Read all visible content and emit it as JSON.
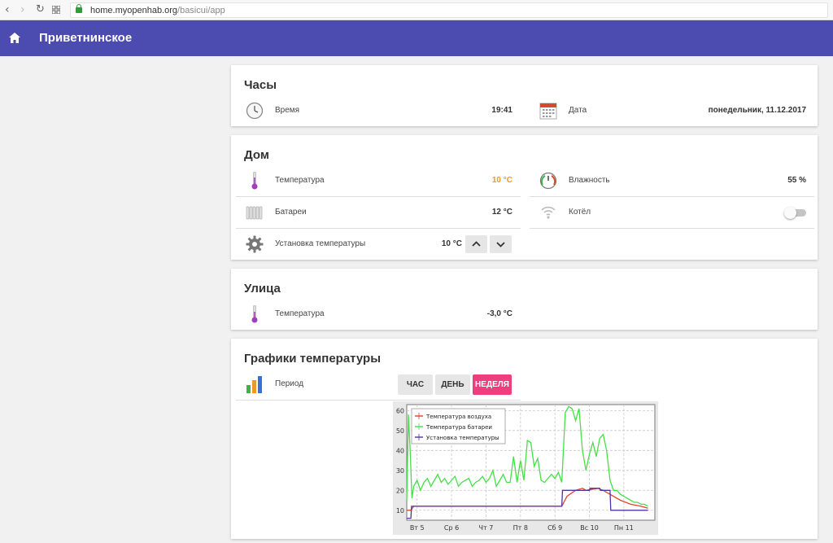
{
  "browser": {
    "url_host": "home.myopenhab.org",
    "url_path": "/basicui/app"
  },
  "header": {
    "title": "Приветнинское"
  },
  "clock": {
    "title": "Часы",
    "time_label": "Время",
    "time_value": "19:41",
    "date_label": "Дата",
    "date_value": "понедельник, 11.12.2017"
  },
  "home": {
    "title": "Дом",
    "temperature_label": "Температура",
    "temperature_value": "10 °C",
    "humidity_label": "Влажность",
    "humidity_value": "55 %",
    "radiators_label": "Батареи",
    "radiators_value": "12 °C",
    "boiler_label": "Котёл",
    "boiler_on": false,
    "setpoint_label": "Установка температуры",
    "setpoint_value": "10 °C"
  },
  "street": {
    "title": "Улица",
    "temperature_label": "Температура",
    "temperature_value": "-3,0 °C"
  },
  "charts": {
    "title": "Графики температуры",
    "period_label": "Период",
    "periods": [
      "ЧАС",
      "ДЕНЬ",
      "НЕДЕЛЯ"
    ],
    "selected_period": "НЕДЕЛЯ"
  },
  "colors": {
    "appbar": "#4c4bb0",
    "accent_pink": "#ef3e7d",
    "temperature_highlight": "#e99a2a",
    "series_air": "#d9482b",
    "series_battery": "#44e048",
    "series_setpoint": "#5231a8"
  },
  "chart_data": {
    "type": "line",
    "title": "",
    "xlabel": "",
    "ylabel": "",
    "categories": [
      "Вт 5",
      "Ср 6",
      "Чт 7",
      "Пт 8",
      "Сб 9",
      "Вс 10",
      "Пн 11"
    ],
    "x_ticks": [
      0.3,
      1.3,
      2.3,
      3.3,
      4.3,
      5.3,
      6.3
    ],
    "y_ticks": [
      10,
      20,
      30,
      40,
      50,
      60
    ],
    "xlim": [
      0,
      7.2
    ],
    "ylim": [
      5,
      63
    ],
    "grid": true,
    "legend": "top-left",
    "series": [
      {
        "name": "Температура воздуха",
        "x": [
          0,
          0.12,
          0.2,
          0.4,
          1.0,
          1.5,
          2.0,
          2.6,
          3.0,
          3.5,
          4.0,
          4.4,
          4.5,
          4.65,
          4.9,
          5.1,
          5.2,
          5.55,
          5.7,
          5.9,
          6.2,
          6.5,
          6.8,
          7.0
        ],
        "values": [
          10,
          10,
          12,
          12,
          12,
          12,
          12,
          12,
          12,
          12,
          12,
          12,
          12,
          17,
          20,
          21,
          20,
          21,
          20,
          18,
          15,
          13,
          12,
          11
        ]
      },
      {
        "name": "Температура батареи",
        "x": [
          0,
          0.05,
          0.1,
          0.15,
          0.2,
          0.3,
          0.4,
          0.5,
          0.6,
          0.7,
          0.8,
          0.9,
          1.0,
          1.1,
          1.2,
          1.3,
          1.4,
          1.5,
          1.6,
          1.7,
          1.8,
          1.9,
          2.0,
          2.1,
          2.2,
          2.3,
          2.4,
          2.5,
          2.6,
          2.7,
          2.8,
          2.9,
          3.0,
          3.1,
          3.2,
          3.3,
          3.4,
          3.5,
          3.6,
          3.7,
          3.8,
          3.9,
          4.0,
          4.1,
          4.2,
          4.3,
          4.4,
          4.5,
          4.6,
          4.7,
          4.8,
          4.9,
          5.0,
          5.1,
          5.2,
          5.3,
          5.4,
          5.5,
          5.6,
          5.7,
          5.8,
          5.9,
          6.0,
          6.1,
          6.2,
          6.3,
          6.4,
          6.5,
          6.6,
          6.7,
          6.8,
          6.9,
          7.0
        ],
        "values": [
          15,
          58,
          40,
          16,
          22,
          25,
          20,
          24,
          26,
          22,
          25,
          28,
          24,
          26,
          23,
          25,
          27,
          22,
          24,
          25,
          26,
          22,
          24,
          25,
          27,
          24,
          26,
          30,
          22,
          25,
          28,
          24,
          24,
          37,
          24,
          35,
          25,
          45,
          44,
          32,
          36,
          25,
          24,
          26,
          28,
          26,
          29,
          24,
          59,
          62,
          61,
          55,
          61,
          40,
          30,
          38,
          44,
          37,
          46,
          48,
          40,
          25,
          20,
          20,
          18,
          17,
          16,
          15,
          14,
          14,
          13,
          13,
          12
        ]
      },
      {
        "name": "Установка температуры",
        "x": [
          0,
          0.12,
          0.14,
          0.2,
          1.0,
          2.0,
          3.0,
          4.0,
          4.5,
          4.52,
          5.3,
          5.32,
          5.6,
          5.62,
          5.9,
          5.92,
          6.5,
          7.0
        ],
        "values": [
          6,
          6,
          12,
          12,
          12,
          12,
          12,
          12,
          12,
          20,
          20,
          21,
          21,
          20,
          20,
          10,
          10,
          10
        ]
      }
    ]
  }
}
